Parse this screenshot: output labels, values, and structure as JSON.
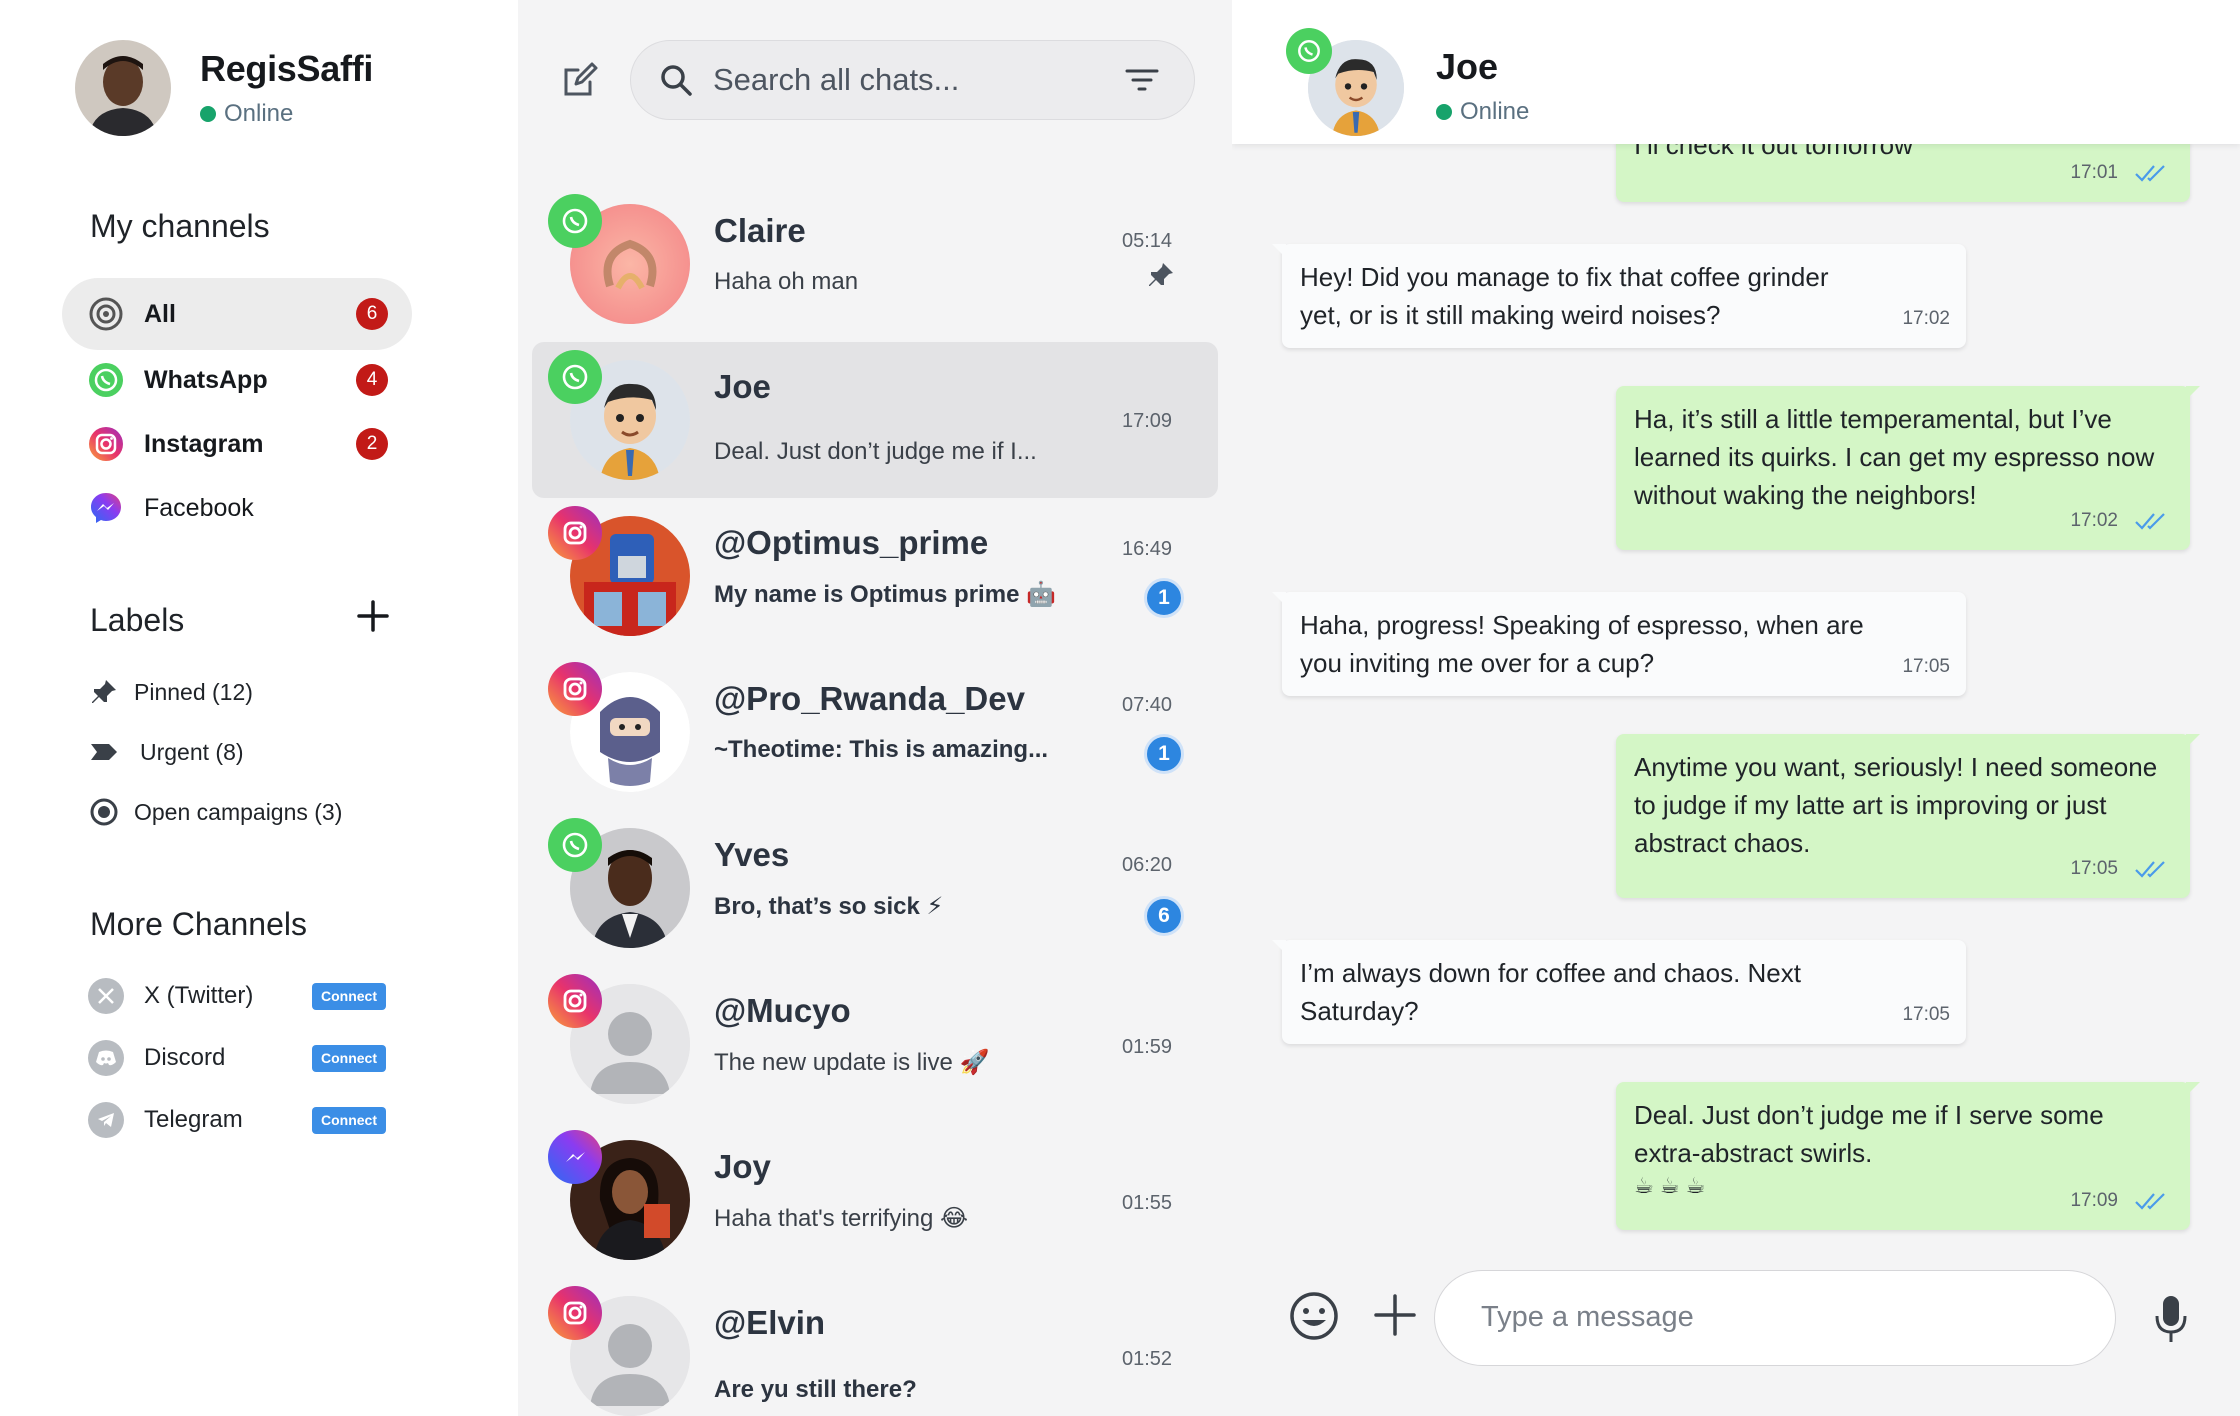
{
  "user": {
    "name": "RegisSaffi",
    "status": "Online"
  },
  "sidebar": {
    "channels_title": "My channels",
    "channels": [
      {
        "label": "All",
        "icon": "all-channels-icon",
        "count": "6",
        "active": true
      },
      {
        "label": "WhatsApp",
        "icon": "whatsapp-icon",
        "count": "4"
      },
      {
        "label": "Instagram",
        "icon": "instagram-icon",
        "count": "2"
      },
      {
        "label": "Facebook",
        "icon": "messenger-icon",
        "count": ""
      }
    ],
    "labels_title": "Labels",
    "labels": [
      {
        "label": "Pinned (12)",
        "icon": "pin-icon"
      },
      {
        "label": "Urgent (8)",
        "icon": "urgent-tag-icon"
      },
      {
        "label": "Open campaigns (3)",
        "icon": "radio-icon"
      }
    ],
    "more_title": "More Channels",
    "more": [
      {
        "label": "X (Twitter)",
        "icon": "x-twitter-icon",
        "action": "Connect"
      },
      {
        "label": "Discord",
        "icon": "discord-icon",
        "action": "Connect"
      },
      {
        "label": "Telegram",
        "icon": "telegram-icon",
        "action": "Connect"
      }
    ]
  },
  "chatlist": {
    "search_placeholder": "Search all chats...",
    "chats": [
      {
        "name": "Claire",
        "preview": "Haha oh man",
        "time": "05:14",
        "platform": "whatsapp",
        "pinned": true,
        "unread": ""
      },
      {
        "name": "Joe",
        "preview": "Deal. Just don’t judge me if I...",
        "time": "17:09",
        "platform": "whatsapp",
        "active": true,
        "unread": ""
      },
      {
        "name": "@Optimus_prime",
        "preview": "My name is Optimus prime 🤖",
        "time": "16:49",
        "platform": "instagram",
        "unread": "1"
      },
      {
        "name": "@Pro_Rwanda_Dev",
        "preview": "~Theotime: This is amazing...",
        "time": "07:40",
        "platform": "instagram",
        "unread": "1"
      },
      {
        "name": "Yves",
        "preview": "Bro, that’s so sick ⚡",
        "time": "06:20",
        "platform": "whatsapp",
        "unread": "6"
      },
      {
        "name": "@Mucyo",
        "preview": "The new update is live 🚀",
        "time": "01:59",
        "platform": "instagram",
        "unread": ""
      },
      {
        "name": "Joy",
        "preview": "Haha that's terrifying 😂",
        "time": "01:55",
        "platform": "messenger",
        "unread": ""
      },
      {
        "name": "@Elvin",
        "preview": "Are yu still there?",
        "time": "01:52",
        "platform": "instagram",
        "unread": ""
      }
    ]
  },
  "conversation": {
    "contact": "Joe",
    "status": "Online",
    "messages": [
      {
        "dir": "out",
        "text": "I’ll check it out tomorrow",
        "time": "17:01"
      },
      {
        "dir": "in",
        "text": "Hey! Did you manage to fix that coffee grinder yet, or is it still making weird noises?",
        "time": "17:02"
      },
      {
        "dir": "out",
        "text": "Ha, it’s still a little temperamental, but I’ve learned its quirks. I can get my espresso now without waking the neighbors!",
        "time": "17:02"
      },
      {
        "dir": "in",
        "text": "Haha, progress! Speaking of espresso, when are you inviting me over for a cup?",
        "time": "17:05"
      },
      {
        "dir": "out",
        "text": "Anytime you want, seriously! I need someone to judge if my latte art is improving or just abstract chaos.",
        "time": "17:05"
      },
      {
        "dir": "in",
        "text": "I’m always down for coffee and chaos. Next Saturday?",
        "time": "17:05"
      },
      {
        "dir": "out",
        "text": "Deal. Just don’t judge me if I serve some extra-abstract swirls.",
        "emoji": "☕ ☕ ☕",
        "time": "17:09"
      }
    ],
    "input_placeholder": "Type a message"
  },
  "colors": {
    "accent": "#2d86e0",
    "badge_red": "#c21a17",
    "online_green": "#17a36b",
    "outgoing_bubble": "#d4f6c6",
    "whatsapp": "#4bd060"
  }
}
